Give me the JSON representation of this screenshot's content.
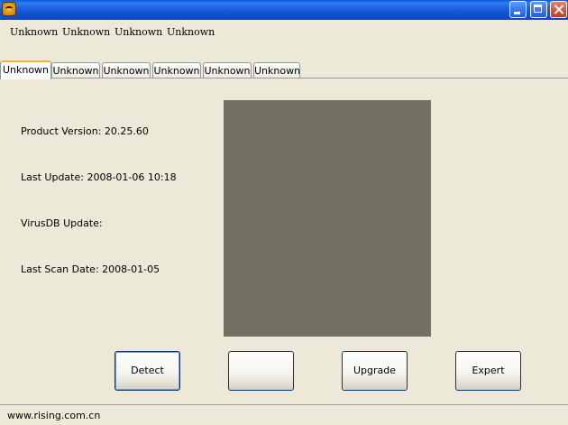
{
  "window": {
    "icon": "tiger-app-icon",
    "controls": [
      "minimize-icon",
      "maximize-icon",
      "close-icon"
    ]
  },
  "menu": [
    "Unknown",
    "Unknown",
    "Unknown",
    "Unknown"
  ],
  "tabs": [
    "Unknown",
    "Unknown",
    "Unknown",
    "Unknown",
    "Unknown",
    "Unknown"
  ],
  "info": {
    "product_version": "Product Version: 20.25.60",
    "last_update": "Last Update: 2008-01-06 10:18",
    "virusdb_update": "VirusDB Update:",
    "last_scan_date": "Last Scan Date: 2008-01-05"
  },
  "buttons": {
    "detect": "Detect",
    "blank": "",
    "upgrade": "Upgrade",
    "expert": "Expert"
  },
  "status": {
    "text": "www.rising.com.cn"
  },
  "colors": {
    "preview_panel": "#737163",
    "titlebar": "#0b55e6",
    "active_tab_accent": "#f7b13b"
  }
}
